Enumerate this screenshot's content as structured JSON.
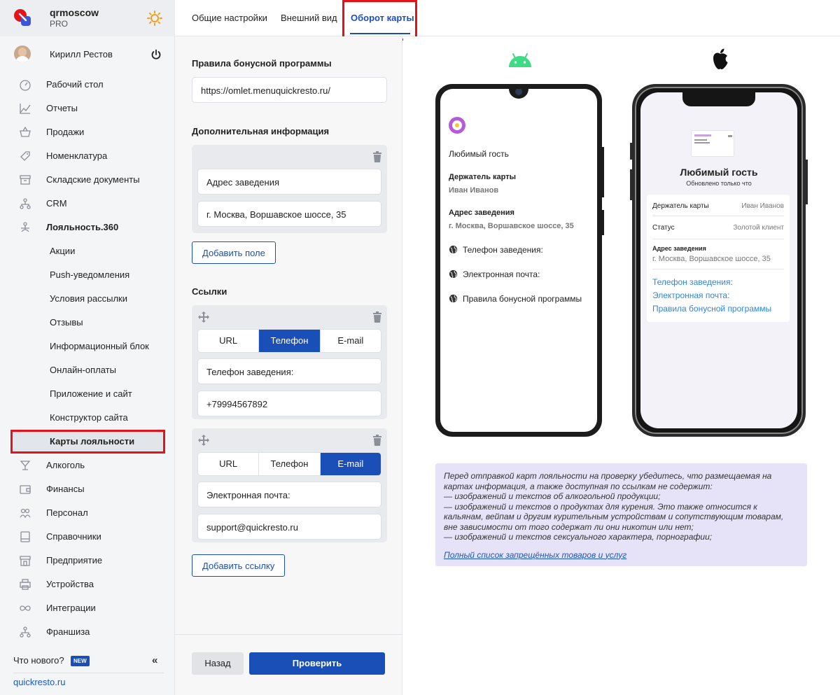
{
  "sidebar": {
    "brand_name": "qrmoscow",
    "brand_plan": "PRO",
    "user_name": "Кирилл Рестов",
    "nav": {
      "desktop": "Рабочий стол",
      "reports": "Отчеты",
      "sales": "Продажи",
      "nomenclature": "Номенклатура",
      "warehouse": "Складские документы",
      "crm": "CRM",
      "loyalty": "Лояльность.360",
      "alcohol": "Алкоголь",
      "finance": "Финансы",
      "staff": "Персонал",
      "directories": "Справочники",
      "enterprise": "Предприятие",
      "devices": "Устройства",
      "integrations": "Интеграции",
      "franchise": "Франшиза"
    },
    "loyalty_items": [
      "Акции",
      "Push-уведомления",
      "Условия рассылки",
      "Отзывы",
      "Информационный блок",
      "Онлайн-оплаты",
      "Приложение и сайт",
      "Конструктор сайта",
      "Карты лояльности"
    ],
    "whats_new": "Что нового?",
    "new_badge": "NEW",
    "collapse": "«",
    "site_link": "quickresto.ru"
  },
  "tabs": [
    "Общие настройки",
    "Внешний вид",
    "Оборот карты"
  ],
  "form": {
    "bonus_rules_title": "Правила бонусной программы",
    "bonus_rules_url": "https://omlet.menuquickresto.ru/",
    "extra_info_title": "Дополнительная информация",
    "extra_info_label": "Адрес заведения",
    "extra_info_value": "г. Москва, Воршавское шоссе, 35",
    "add_field": "Добавить поле",
    "links_title": "Ссылки",
    "seg_url": "URL",
    "seg_phone": "Телефон",
    "seg_email": "E-mail",
    "link1_label": "Телефон заведения:",
    "link1_value": "+79994567892",
    "link2_label": "Электронная почта:",
    "link2_value": "support@quickresto.ru",
    "add_link": "Добавить ссылку",
    "back": "Назад",
    "check": "Проверить"
  },
  "android_preview": {
    "title": "Любимый гость",
    "holder_label": "Держатель карты",
    "holder_value": "Иван Иванов",
    "address_label": "Адрес заведения",
    "address_value": "г. Москва, Воршавское шоссе, 35",
    "links": [
      "Телефон заведения:",
      "Электронная почта:",
      "Правила бонусной программы"
    ]
  },
  "ios_preview": {
    "title": "Любимый гость",
    "subtitle": "Обновлено только что",
    "holder_label": "Держатель карты",
    "holder_value": "Иван Иванов",
    "status_label": "Статус",
    "status_value": "Золотой клиент",
    "address_label": "Адрес заведения",
    "address_value": "г. Москва, Воршавское шоссе, 35",
    "links": [
      "Телефон заведения:",
      "Электронная почта:",
      "Правила бонусной программы"
    ]
  },
  "notice": {
    "text": "Перед отправкой карт лояльности на проверку убедитесь, что размещаемая на картах информация, а также доступная по ссылкам не содержит:\n— изображений и текстов об алкогольной продукции;\n— изображений и текстов о продуктах для курения. Это также относится к кальянам, вейпам и другим курительным устройствам и сопутствующим товарам, вне зависимости от того содержат ли они никотин или нет;\n— изображений и текстов сексуального характера, порнографии;",
    "link": "Полный список запрещённых товаров и услуг"
  },
  "colors": {
    "accent": "#1a4fb8",
    "highlight": "#e3131a",
    "notice_bg": "#e6e3f8"
  },
  "icons": {
    "theme": "sun-icon",
    "logout": "power-icon",
    "remove": "trash-icon",
    "reorder": "move-icon",
    "link": "globe-icon"
  }
}
